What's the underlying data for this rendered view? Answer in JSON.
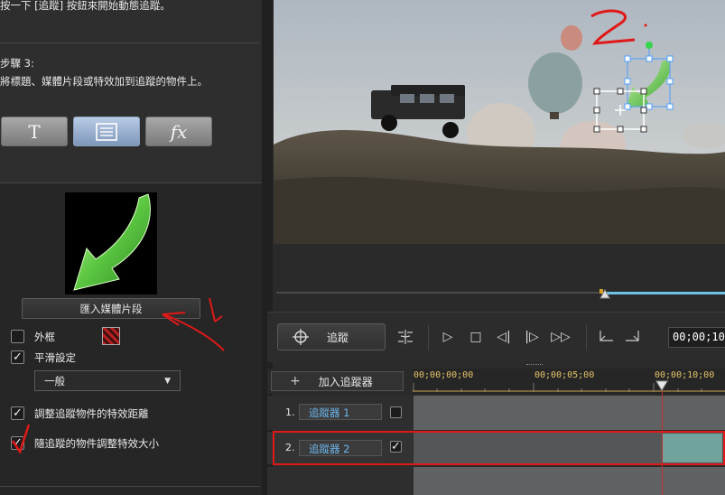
{
  "left_panel": {
    "instruction_top": "按一下 [追蹤] 按鈕來開始動態追蹤。",
    "step_title": "步驟 3:",
    "step_desc": "將標題、媒體片段或特效加到追蹤的物件上。",
    "buttons": {
      "title_glyph": "T",
      "fx_glyph": "fx"
    },
    "import_media_label": "匯入媒體片段",
    "frame_label": "外框",
    "frame_checked": false,
    "smooth_label": "平滑設定",
    "smooth_checked": true,
    "smooth_select_value": "一般",
    "adjust_distance_label": "調整追蹤物件的特效距離",
    "adjust_distance_checked": true,
    "adjust_size_label": "隨追蹤的物件調整特效大小",
    "adjust_size_checked": true
  },
  "annotations": {
    "mark_1": "1.",
    "mark_2": "2."
  },
  "controls": {
    "track_label": "追蹤",
    "timecode": "00;00;10"
  },
  "timeline": {
    "add_tracker_label": "加入追蹤器",
    "ticks": [
      "00;00;00;00",
      "00;00;05;00",
      "00;00;10;00"
    ],
    "trackers": [
      {
        "num": "1.",
        "name": "追蹤器 1",
        "checked": false
      },
      {
        "num": "2.",
        "name": "追蹤器 2",
        "checked": true
      }
    ]
  },
  "colors": {
    "accent_blue": "#6ec2e6",
    "annotation_red": "#e01818",
    "tracker_text": "#6db8ef",
    "clip_teal": "#6fa39b"
  }
}
